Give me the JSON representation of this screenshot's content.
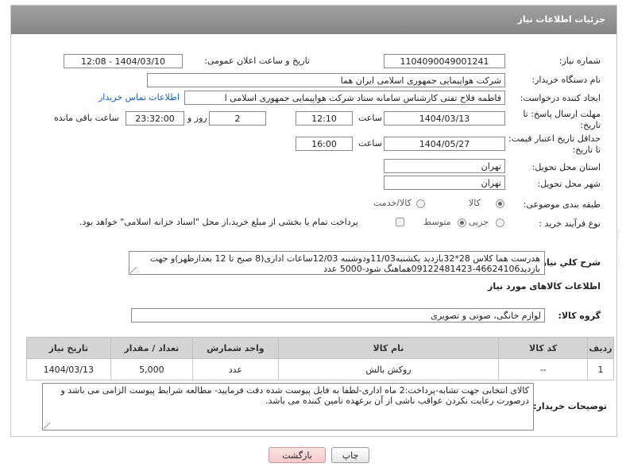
{
  "panel": {
    "title": "جزئیات اطلاعات نیاز"
  },
  "fields": {
    "need_number_label": "شماره نیاز:",
    "need_number": "1104090049001241",
    "announce_label": "تاریخ و ساعت اعلان عمومی:",
    "announce_value": "1404/03/10 - 12:08",
    "buyer_org_label": "نام دستگاه خریدار:",
    "buyer_org": "شرکت هواپیمایی جمهوری اسلامی ایران هما",
    "creator_label": "ایجاد کننده درخواست:",
    "creator": "فاطمه فلاح تفتی کارشناس سامانه ستاد شرکت هواپیمایی جمهوری اسلامی ا",
    "buyer_contact_link": "اطلاعات تماس خریدار",
    "reply_deadline_label_1": "مهلت ارسال پاسخ: تا",
    "reply_deadline_label_2": "تاریخ:",
    "reply_date": "1404/03/13",
    "time_label": "ساعت",
    "reply_time": "12:10",
    "days_value": "2",
    "days_label": "روز و",
    "remaining_time": "23:32:00",
    "remaining_label": "ساعت باقی مانده",
    "price_validity_label_1": "حداقل تاریخ اعتبار قیمت:",
    "price_validity_label_2": "تا تاریخ:",
    "validity_date": "1404/05/27",
    "validity_time": "16:00",
    "province_label": "استان محل تحویل:",
    "province": "تهران",
    "city_label": "شهر محل تحویل:",
    "city": "تهران",
    "category_label": "طبقه بندی موضوعی:",
    "category_options": [
      "کالا",
      "کالا/خدمت"
    ],
    "category_selected": "کالا",
    "process_label": "نوع فرآیند خرید :",
    "process_options": [
      "جزیی",
      "متوسط"
    ],
    "process_selected": "متوسط",
    "treasury_note": "پرداخت تمام یا بخشی از مبلغ خرید،از محل \"اسناد خزانه اسلامی\" خواهد بود."
  },
  "description": {
    "label": "شرح کلي نياز:",
    "text": "هدرست هما کلاس 28*32بازدید یکشنبه11/03ودوشنبه 12/03ساعات اداری(8 صبح تا 12 بعدازظهر)و جهت بازدید46624106-09122481423هماهنگ شود-5000 عدد"
  },
  "goods_info": {
    "title": "اطلاعات کالاهای مورد نیاز",
    "group_label": "گروه کالا:",
    "group_value": "لوازم خانگی، صوتی و تصویری"
  },
  "table": {
    "headers": [
      "ردیف",
      "کد کالا",
      "نام کالا",
      "واحد شمارش",
      "تعداد / مقدار",
      "تاریخ نیاز"
    ],
    "rows": [
      [
        "1",
        "--",
        "روکش بالش",
        "عدد",
        "5,000",
        "1404/03/13"
      ]
    ]
  },
  "buyer_notes": {
    "label": "توضیحات خریدار:",
    "text": "کالای انتخابی جهت تشابه-پرداخت:2 ماه اداری-لطفا به فایل پیوست شده دقت فرمایید- مطالعه شرایط پیوست الزامی می باشد و درصورت رعایت نکردن عواقب ناشی از آن برعهده تامین کننده می باشد."
  },
  "buttons": {
    "print": "چاپ",
    "return": "بازگشت"
  },
  "watermark": {
    "text": "AriaTender.neT"
  }
}
